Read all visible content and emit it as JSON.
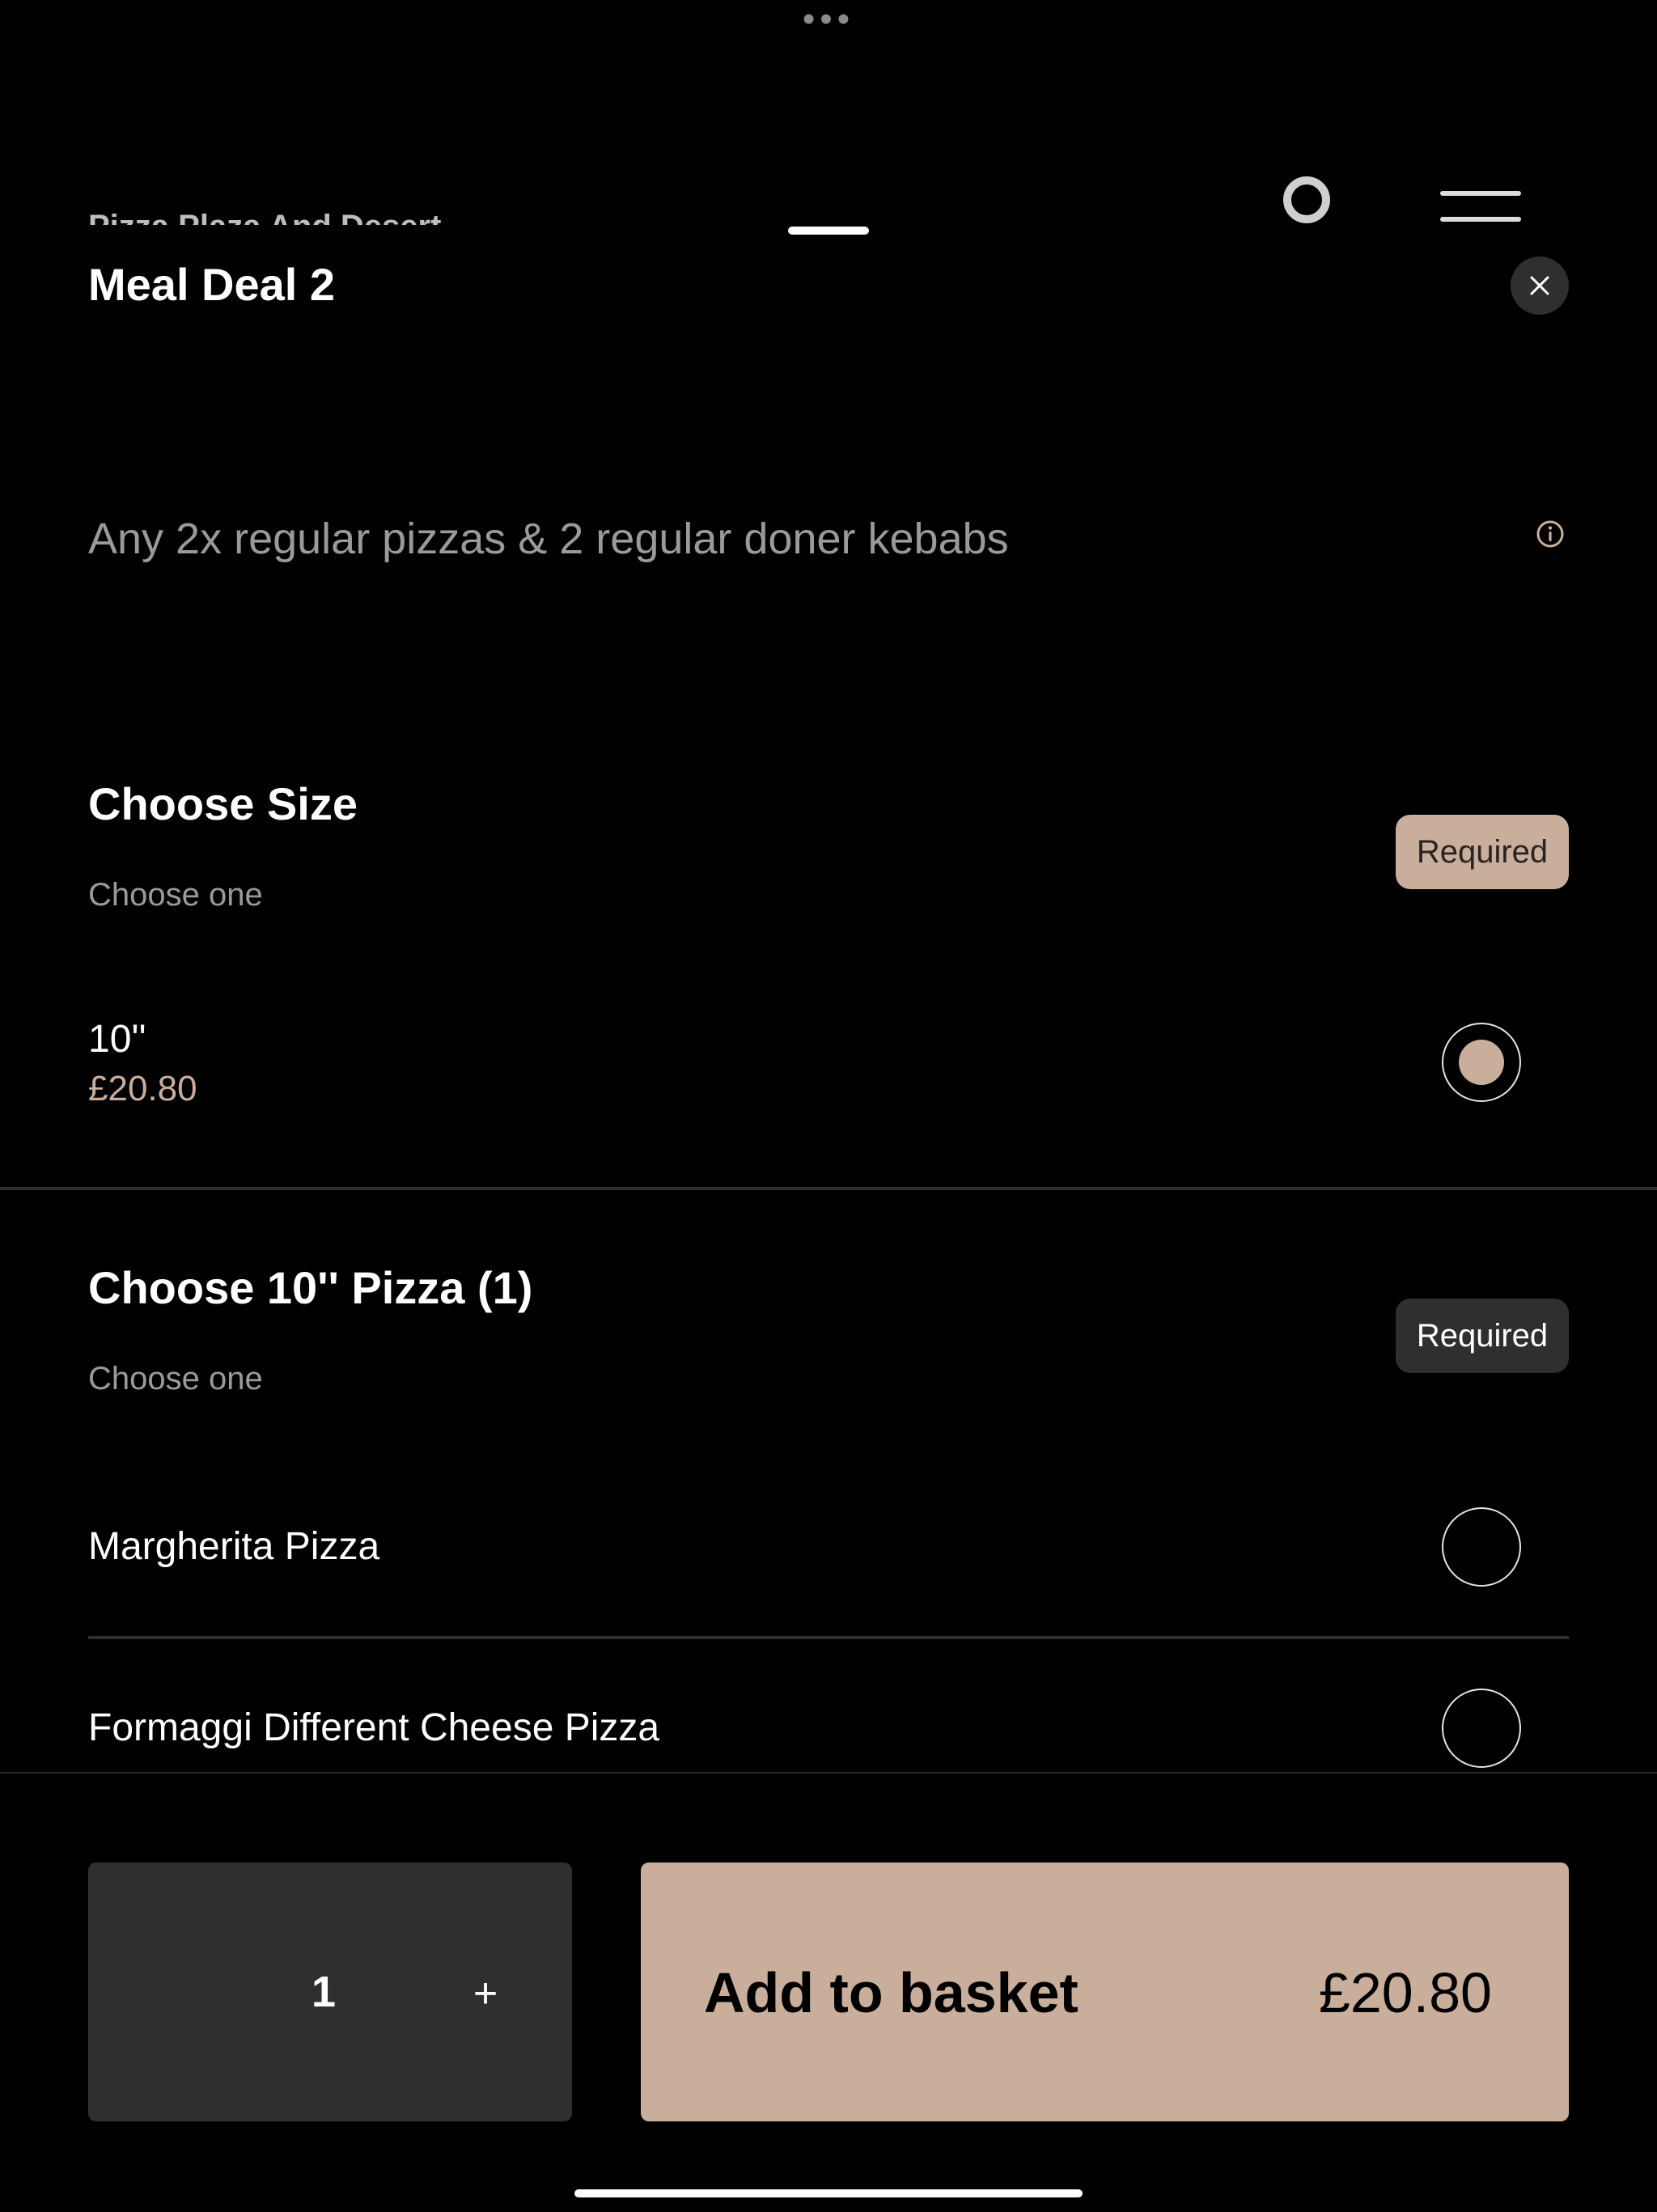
{
  "top": {
    "dots": "•••",
    "restaurant_name": "Pizza Plaza And Desert"
  },
  "modal": {
    "title": "Meal Deal 2",
    "description": "Any 2x regular pizzas & 2 regular doner kebabs",
    "close_icon": "close-icon",
    "info_icon": "info-icon"
  },
  "sections": [
    {
      "title": "Choose Size",
      "subtitle": "Choose one",
      "badge": "Required",
      "options": [
        {
          "name": "10''",
          "price": "£20.80",
          "selected": true
        }
      ]
    },
    {
      "title": "Choose 10'' Pizza (1)",
      "subtitle": "Choose one",
      "badge": "Required",
      "options": [
        {
          "name": "Margherita Pizza",
          "selected": false
        },
        {
          "name": "Formaggi Different Cheese Pizza",
          "selected": false
        }
      ]
    }
  ],
  "footer": {
    "quantity": "1",
    "plus": "+",
    "add_label": "Add to basket",
    "add_price": "£20.80"
  },
  "colors": {
    "accent": "#c9ae9c",
    "surface": "#2f2f2f",
    "background": "#000000",
    "muted_text": "#9a9a9a"
  }
}
